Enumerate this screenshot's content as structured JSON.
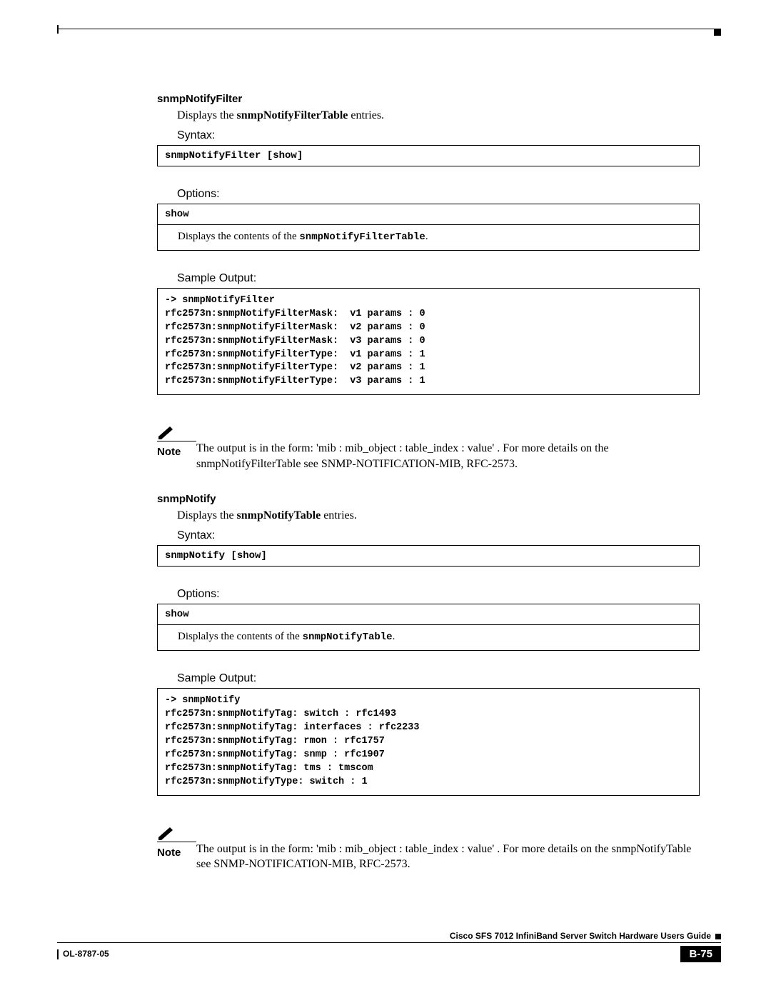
{
  "section1": {
    "title": "snmpNotifyFilter",
    "desc_prefix": "Displays the ",
    "desc_bold": "snmpNotifyFilterTable",
    "desc_suffix": " entries.",
    "syntax_label": "Syntax:",
    "syntax_cmd": "snmpNotifyFilter [show]",
    "options_label": "Options:",
    "options_header": "show",
    "options_body_prefix": "Displays the contents of the ",
    "options_body_mono": "snmpNotifyFilterTable",
    "options_body_suffix": ".",
    "sample_label": "Sample Output:",
    "sample_output": "-> snmpNotifyFilter\nrfc2573n:snmpNotifyFilterMask:  v1 params : 0\nrfc2573n:snmpNotifyFilterMask:  v2 params : 0\nrfc2573n:snmpNotifyFilterMask:  v3 params : 0\nrfc2573n:snmpNotifyFilterType:  v1 params : 1\nrfc2573n:snmpNotifyFilterType:  v2 params : 1\nrfc2573n:snmpNotifyFilterType:  v3 params : 1",
    "note_label": "Note",
    "note_text": "The output is in the form: 'mib : mib_object : table_index : value' . For more details on the snmpNotifyFilterTable see SNMP-NOTIFICATION-MIB, RFC-2573."
  },
  "section2": {
    "title": "snmpNotify",
    "desc_prefix": "Displays the ",
    "desc_bold": "snmpNotifyTable",
    "desc_suffix": " entries.",
    "syntax_label": "Syntax:",
    "syntax_cmd": "snmpNotify [show]",
    "options_label": "Options:",
    "options_header": "show",
    "options_body_prefix": "Displalys the contents of the ",
    "options_body_mono": "snmpNotifyTable",
    "options_body_suffix": ".",
    "sample_label": "Sample Output:",
    "sample_output": "-> snmpNotify\nrfc2573n:snmpNotifyTag: switch : rfc1493\nrfc2573n:snmpNotifyTag: interfaces : rfc2233\nrfc2573n:snmpNotifyTag: rmon : rfc1757\nrfc2573n:snmpNotifyTag: snmp : rfc1907\nrfc2573n:snmpNotifyTag: tms : tmscom\nrfc2573n:snmpNotifyType: switch : 1",
    "note_label": "Note",
    "note_text": "The output is in the form: 'mib : mib_object : table_index : value' . For more details on the snmpNotifyTable see SNMP-NOTIFICATION-MIB, RFC-2573."
  },
  "footer": {
    "title": "Cisco SFS 7012 InfiniBand Server Switch Hardware Users Guide",
    "doc_id": "OL-8787-05",
    "page": "B-75"
  }
}
